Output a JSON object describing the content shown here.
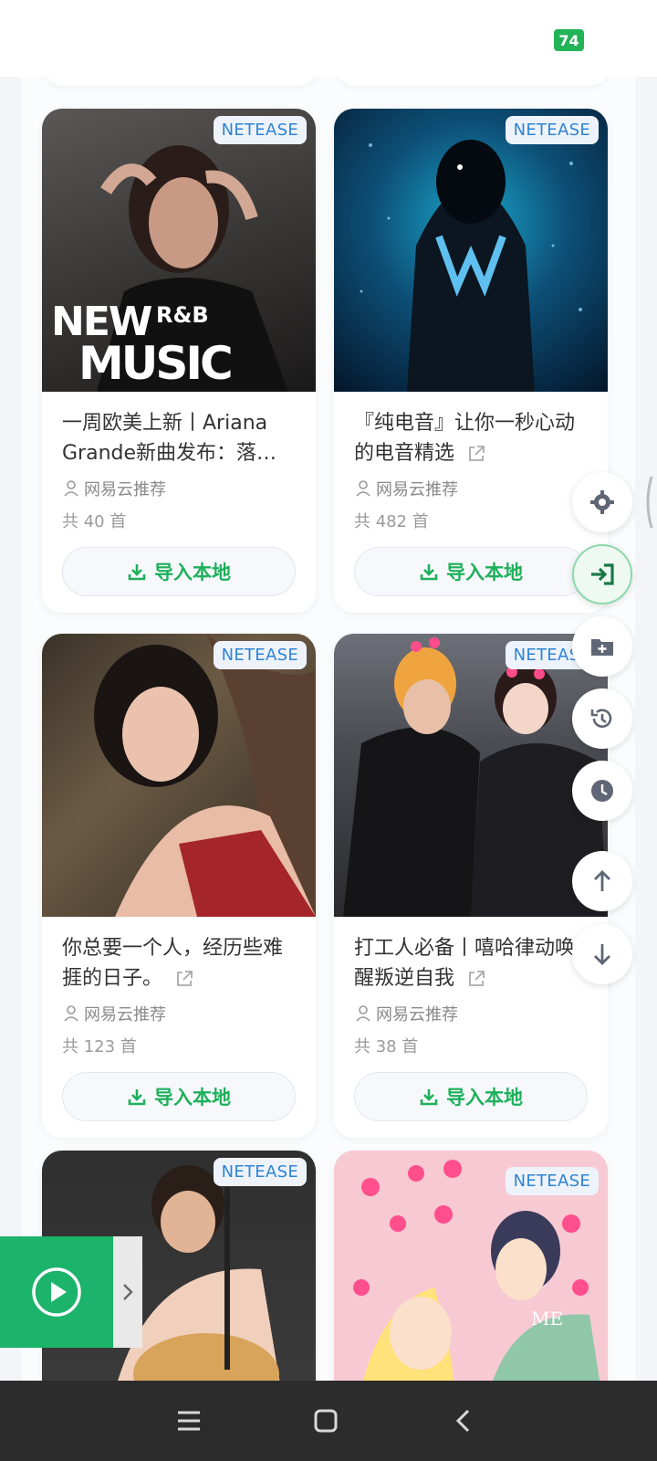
{
  "status_bar": {
    "battery": "74"
  },
  "cards": [
    {
      "badge": "NETEASE",
      "title": "一周欧美上新丨Ariana Grande新曲发布：落…",
      "author": "网易云推荐",
      "count": "共 40 首",
      "import_label": "导入本地",
      "cover_text_1": "NEW",
      "cover_text_2": "R&B",
      "cover_text_3": "MUSIC"
    },
    {
      "badge": "NETEASE",
      "title": "『纯电音』让你一秒心动的电音精选",
      "author": "网易云推荐",
      "count": "共 482 首",
      "import_label": "导入本地"
    },
    {
      "badge": "NETEASE",
      "title": "你总要一个人，经历些难捱的日子。",
      "author": "网易云推荐",
      "count": "共 123 首",
      "import_label": "导入本地"
    },
    {
      "badge": "NETEASE",
      "title": "打工人必备丨嘻哈律动唤醒叛逆自我",
      "author": "网易云推荐",
      "count": "共 38 首",
      "import_label": "导入本地"
    },
    {
      "badge": "NETEASE"
    },
    {
      "badge": "NETEASE",
      "cover_text": "ME"
    }
  ],
  "fab_icons": [
    "gear-icon",
    "sign-in-icon",
    "folder-plus-icon",
    "history-icon",
    "clock-icon",
    "arrow-up-icon",
    "arrow-down-icon"
  ],
  "colors": {
    "accent": "#1eb05a",
    "badge_text": "#2f84d3",
    "player": "#1cb36b"
  }
}
